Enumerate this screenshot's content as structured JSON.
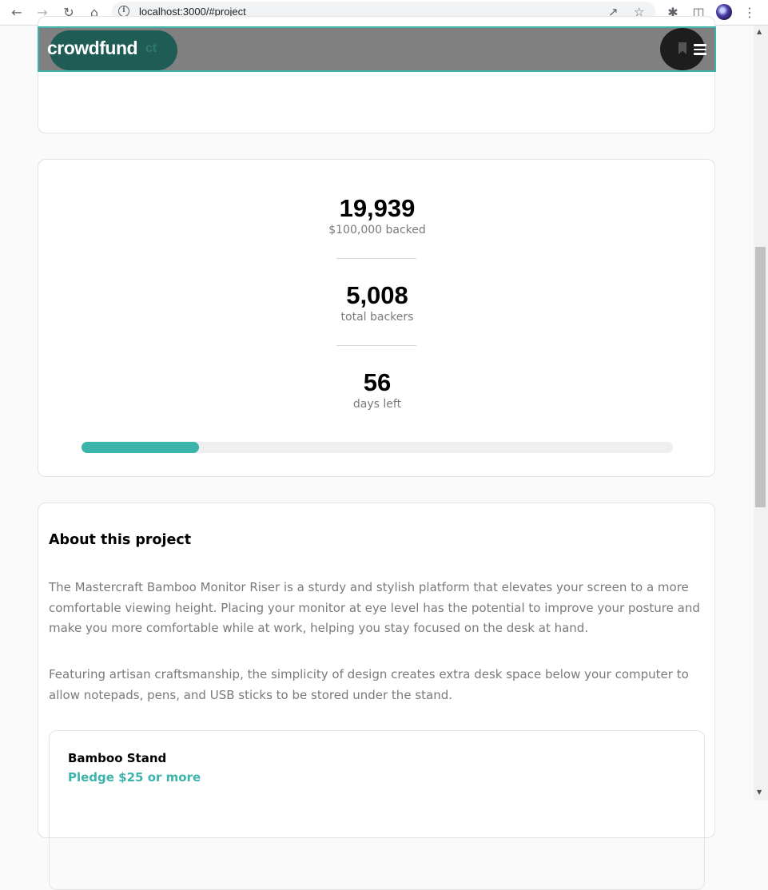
{
  "browser": {
    "url": "localhost:3000/#project"
  },
  "header": {
    "logo": "crowdfund",
    "ghost_text": "ct"
  },
  "stats": {
    "backed_amount": "19,939",
    "backed_label": "$100,000 backed",
    "backers": "5,008",
    "backers_label": "total backers",
    "days": "56",
    "days_label": "days left",
    "progress_fraction": 0.199
  },
  "about": {
    "title": "About this project",
    "paragraphs": [
      "The Mastercraft Bamboo Monitor Riser is a sturdy and stylish platform that elevates your screen to a more comfortable viewing height. Placing your monitor at eye level has the potential to improve your posture and make you more comfortable while at work, helping you stay focused on the desk at hand.",
      "Featuring artisan craftsmanship, the simplicity of design creates extra desk space below your computer to allow notepads, pens, and USB sticks to be stored under the stand."
    ],
    "rewards": [
      {
        "name": "Bamboo Stand",
        "pledge": "Pledge $25 or more"
      }
    ]
  },
  "colors": {
    "accent": "#3cb3ab",
    "accent_dark": "#1f5c55"
  }
}
